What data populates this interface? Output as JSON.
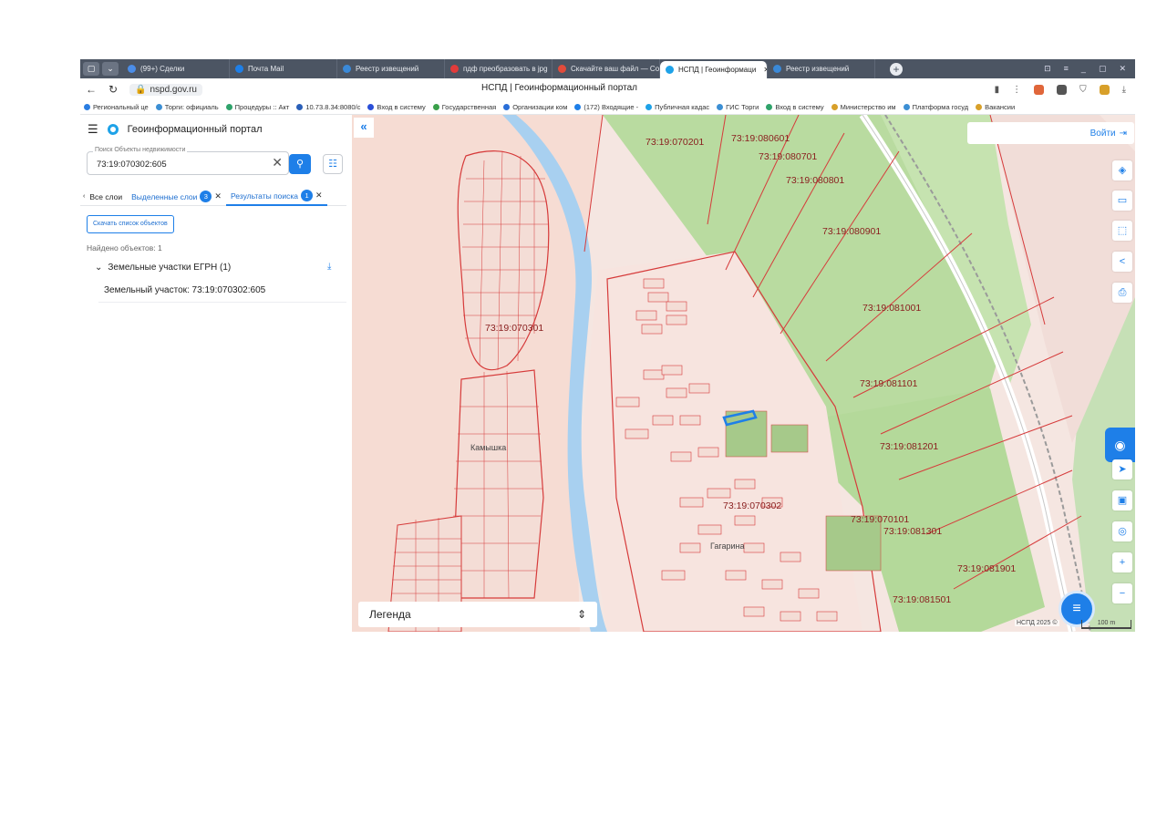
{
  "browser": {
    "tabs": [
      {
        "label": "(99+) Сделки",
        "color": "#4b8de8",
        "active": false
      },
      {
        "label": "Почта Mail",
        "color": "#1e7fe8",
        "active": false
      },
      {
        "label": "Реестр извещений",
        "color": "#3a89d8",
        "active": false
      },
      {
        "label": "пдф преобразовать в jpg",
        "color": "#e23b3b",
        "active": false
      },
      {
        "label": "Скачайте ваш файл — Co",
        "color": "#e24b3b",
        "active": false
      },
      {
        "label": "НСПД | Геоинформаци",
        "color": "#1ea2e8",
        "active": true
      },
      {
        "label": "Реестр извещений",
        "color": "#3a89d8",
        "active": false
      }
    ],
    "url": "nspd.gov.ru",
    "page_title": "НСПД | Геоинформационный портал",
    "bookmarks": [
      {
        "label": "Региональный це",
        "color": "#2a7de1"
      },
      {
        "label": "Торги: официаль",
        "color": "#3c8fd4"
      },
      {
        "label": "Процедуры :: Акт",
        "color": "#2fa36b"
      },
      {
        "label": "10.73.8.34:8080/c",
        "color": "#2a5fb8"
      },
      {
        "label": "Вход в систему",
        "color": "#2a4fd8"
      },
      {
        "label": "Государственная",
        "color": "#3aa04a"
      },
      {
        "label": "Организации ком",
        "color": "#2a6fd8"
      },
      {
        "label": "(172) Входящие -",
        "color": "#1e7fe8"
      },
      {
        "label": "Публичная кадас",
        "color": "#1ea2e8"
      },
      {
        "label": "ГИС Торги",
        "color": "#3c8fd4"
      },
      {
        "label": "Вход в систему",
        "color": "#2fa36b"
      },
      {
        "label": "Министерство им",
        "color": "#d8a02a"
      },
      {
        "label": "Платформа госуд",
        "color": "#3c8fd4"
      },
      {
        "label": "Вакансии",
        "color": "#d8a02a"
      }
    ]
  },
  "sidebar": {
    "title": "Геоинформационный портал",
    "search": {
      "label": "Поиск Объекты недвижимости",
      "value": "73:19:070302:605"
    },
    "tabs": [
      {
        "label": "Все слои",
        "badge": "",
        "closable": false
      },
      {
        "label": "Выделенные слои",
        "badge": "3",
        "closable": true
      },
      {
        "label": "Результаты поиска",
        "badge": "1",
        "closable": true
      }
    ],
    "download_list_label": "Скачать список объектов",
    "found_text": "Найдено объектов: 1",
    "group_label": "Земельные участки ЕГРН (1)",
    "result_item": "Земельный участок: 73:19:070302:605"
  },
  "map": {
    "login_label": "Войти",
    "legend_label": "Легенда",
    "attribution": "НСПД 2025 ©",
    "scale": "100 m",
    "cadastral_labels": [
      "73:19:070201",
      "73:19:080601",
      "73:19:080701",
      "73:19:080801",
      "73:19:080901",
      "73:19:081001",
      "73:19:081101",
      "73:19:081201",
      "73:19:070101",
      "73:19:081301",
      "73:19:081901",
      "73:19:081501",
      "73:19:070302",
      "73:19:070301"
    ],
    "place_labels": [
      "Камышка",
      "Гагарина"
    ]
  }
}
